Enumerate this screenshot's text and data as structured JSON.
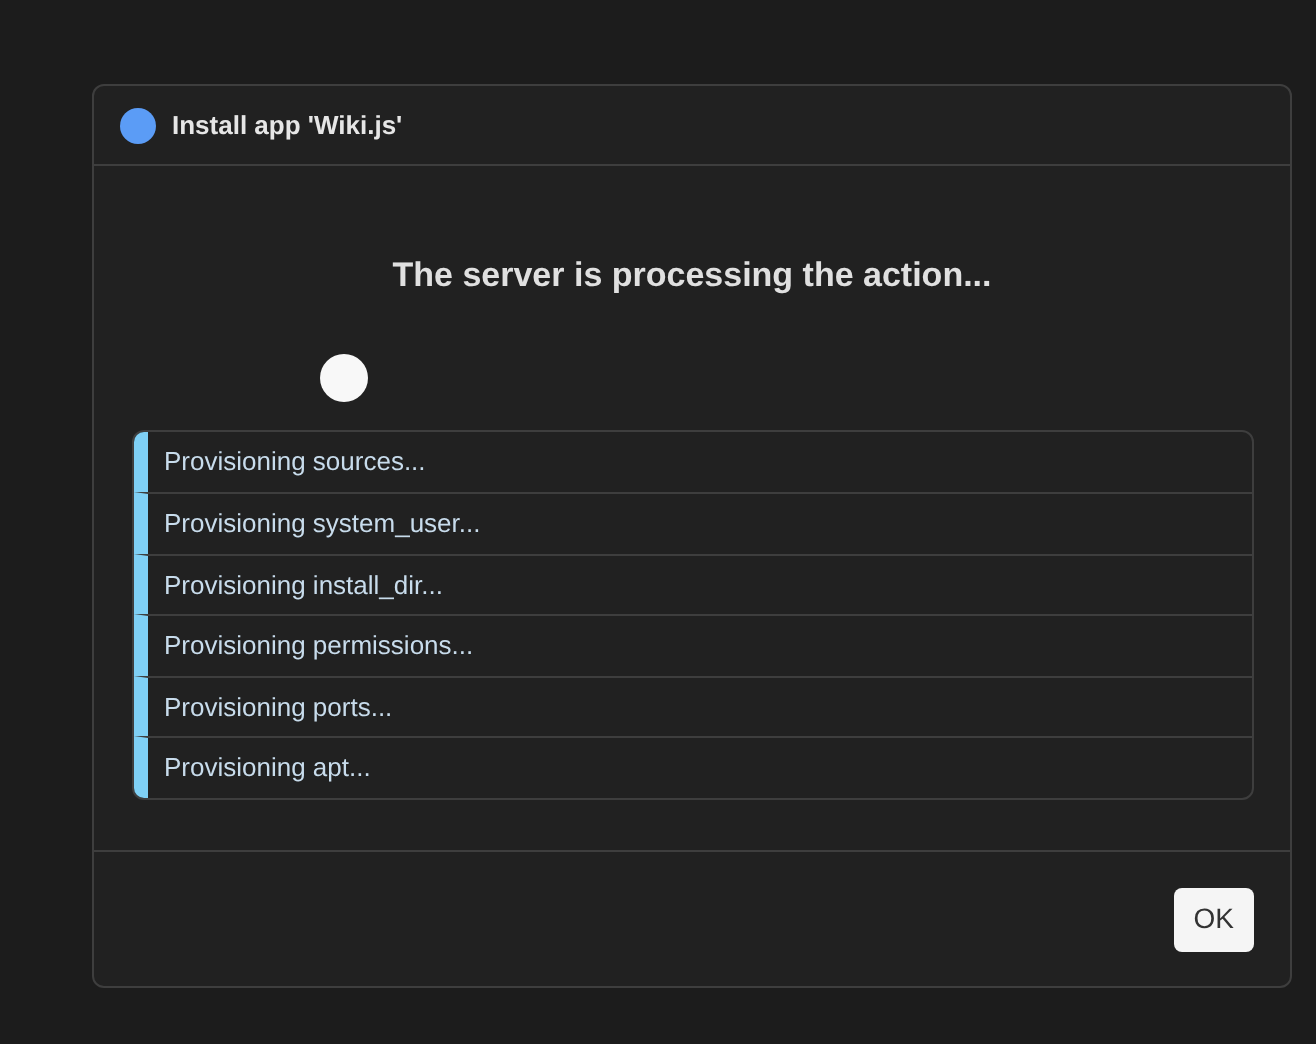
{
  "dialog": {
    "title": "Install app 'Wiki.js'",
    "message": "The server is processing the action...",
    "log": [
      "Provisioning sources...",
      "Provisioning system_user...",
      "Provisioning install_dir...",
      "Provisioning permissions...",
      "Provisioning ports...",
      "Provisioning apt..."
    ],
    "buttons": [
      "OK"
    ]
  }
}
